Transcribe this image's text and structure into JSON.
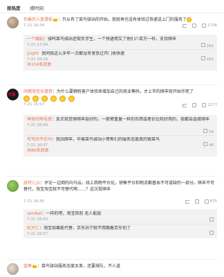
{
  "tabs": [
    {
      "label": "按热度"
    },
    {
      "label": "按时间"
    }
  ],
  "comments": [
    {
      "name": "伪善的人真谭伯",
      "text": "：只从有了菜鸟驿站的开始，我就再也没有体验过快递送上门的服务了",
      "time": "7-21 16:34",
      "actions": {
        "forward": "",
        "reply": "",
        "likes": "1736"
      },
      "replies": [
        {
          "name": "一个蹦跶",
          "text": "：驿呜菜鸟驿站还取负学生，一个快递用又了他们八百万一样，支持顺丰",
          "time": "7-21 17:04",
          "likes": "292"
        },
        {
          "name": "JUqM",
          "text": "：我同我这么多年一次都没有享受过开门收快递",
          "time": "7-21 18:26",
          "likes": "182"
        }
      ],
      "more": "共104条回复"
    },
    {
      "name": "闹猪淘宝优惠券",
      "text": "：为什么要牺牲客户体验来增加自己的商业筹码，才上市的顺丰就开始作死了",
      "time": "7-21 15:57",
      "actions": {
        "forward": "",
        "reply": "",
        "likes": "1277"
      },
      "replies": [
        {
          "name": "神奇的熊毛侠",
          "text": "：反正我觉得顺丰挺好的，一般寄重量一样的东西或者价比较好用的，我都会选择顺丰",
          "time": "7-21 16:04",
          "likes": "56"
        },
        {
          "name": "可可的不在叫",
          "text": "：我站顺丰，毕竟菜鸟驿站小哥帮们的服务态度真的很菜鸟",
          "time": "7-21 16:07",
          "likes": "48"
        }
      ],
      "more": "共86条回复"
    },
    {
      "name": "皮特儿沙",
      "text": "：评论一边倒的向马云。线上购物平台化，销售平台和物流都基本不可或缺的一部分。顺丰不可替代，淘宝淘宝就不可替代啊……？这次挺顺丰",
      "time": "7-21 16:35",
      "actions": {
        "forward": "",
        "reply": "",
        "likes": "875"
      },
      "replies": [
        {
          "name": "iamAat",
          "text": "：一样的吧，淘宝目前 无人能敌",
          "time": "7-21 16:50",
          "likes": ""
        },
        {
          "name": "纪大仁",
          "text": "：淘宝如果能代替，京东苏宁就不用跟着京东怕了",
          "time": "7-21 16:57",
          "likes": ""
        }
      ],
      "more": ""
    },
    {
      "name": "蓝框",
      "text": "：菜鸟驿站服务态度太差，还要排队，不人道",
      "time": "",
      "actions": {
        "forward": "",
        "reply": "",
        "likes": ""
      },
      "replies": [],
      "more": ""
    }
  ]
}
